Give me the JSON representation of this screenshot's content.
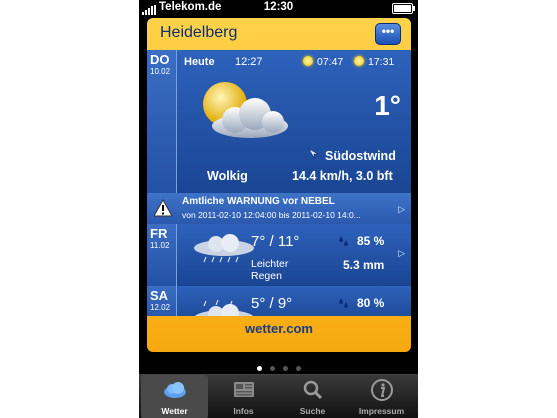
{
  "status_bar": {
    "carrier": "Telekom.de",
    "time": "12:30"
  },
  "header": {
    "city": "Heidelberg",
    "menu_button": "•••"
  },
  "today": {
    "day": "DO",
    "date": "10.02",
    "label": "Heute",
    "time": "12:27",
    "sunrise": "07:47",
    "sunset": "17:31",
    "temperature": "1°",
    "condition": "Wolkig",
    "wind_direction": "Südostwind",
    "wind_speed": "14.4 km/h, 3.0 bft",
    "weather_icon": "sun-behind-cloud-icon"
  },
  "warning": {
    "title": "Amtliche WARNUNG vor NEBEL",
    "text": "von 2011-02-10 12:04:00 bis 2011-02-10 14:0..."
  },
  "forecast": [
    {
      "day": "FR",
      "date": "11.02",
      "temps": "7° / 11°",
      "description_line1": "Leichter",
      "description_line2": "Regen",
      "precip_probability": "85 %",
      "precip_amount": "5.3 mm",
      "icon": "light-rain-cloud-icon"
    },
    {
      "day": "SA",
      "date": "12.02",
      "temps": "5° / 9°",
      "precip_probability": "80 %",
      "icon": "rain-cloud-icon"
    }
  ],
  "brand": "wetter.com",
  "page_indicator": {
    "count": 4,
    "active": 1
  },
  "tabs": [
    {
      "label": "Wetter",
      "icon": "weather-cloud-icon",
      "selected": true
    },
    {
      "label": "Infos",
      "icon": "news-icon",
      "selected": false
    },
    {
      "label": "Suche",
      "icon": "search-icon",
      "selected": false
    },
    {
      "label": "Impressum",
      "icon": "info-icon",
      "selected": false
    }
  ],
  "colors": {
    "accent_yellow": "#f6a90e",
    "panel_blue": "#1d4a9c",
    "text_navy": "#0e2f6e"
  }
}
